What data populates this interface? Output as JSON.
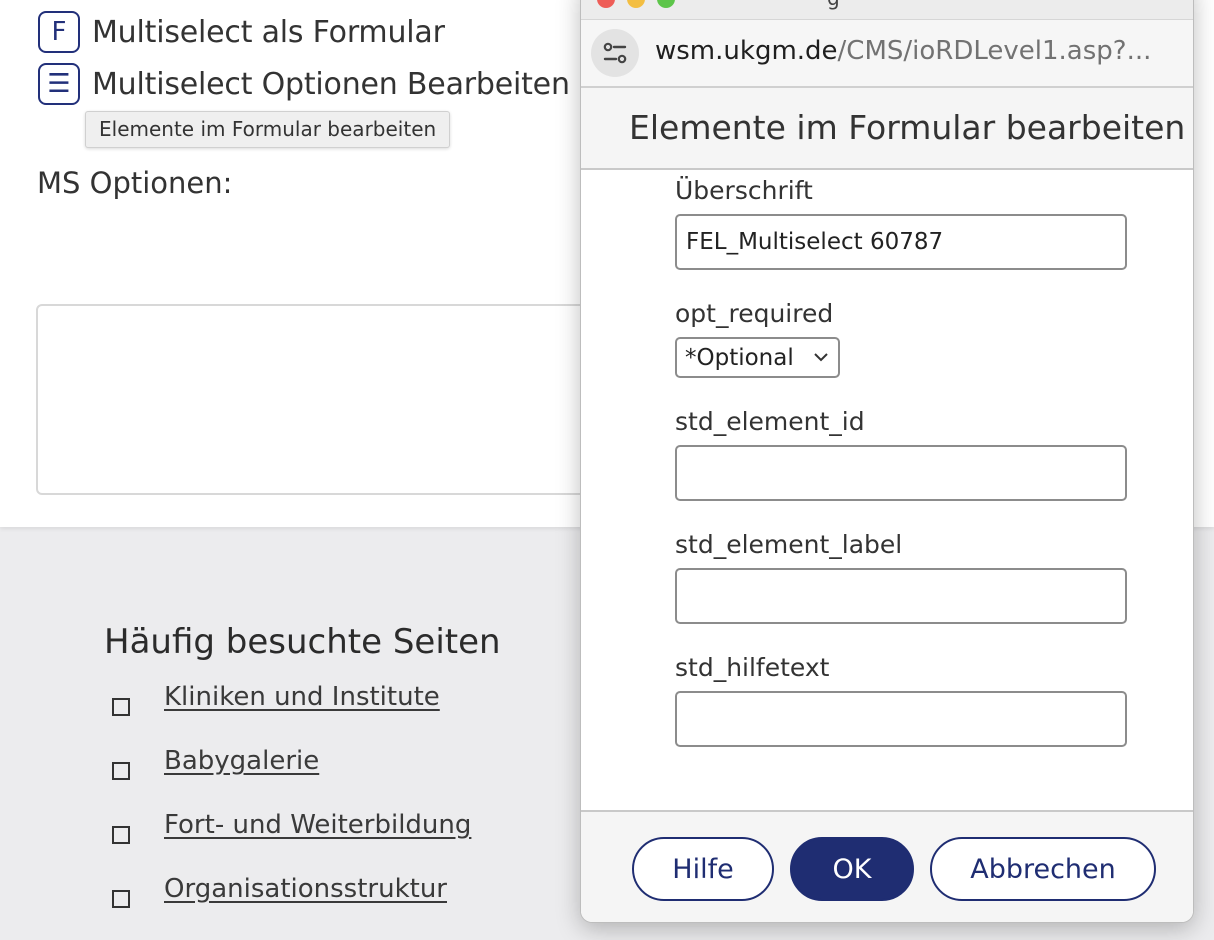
{
  "background": {
    "tools": [
      {
        "icon_glyph": "F",
        "icon_name": "form-icon",
        "label": "Multiselect als Formular"
      },
      {
        "icon_glyph": "☰",
        "icon_name": "list-icon",
        "label": "Multiselect Optionen Bearbeiten"
      }
    ],
    "tooltip": "Elemente im Formular bearbeiten",
    "ms_options_label": "MS Optionen:",
    "frequent": {
      "title": "Häufig besuchte Seiten",
      "links": [
        "Kliniken und Institute",
        "Babygalerie",
        "Fort- und Weiterbildung",
        "Organisationsstruktur"
      ]
    }
  },
  "popup": {
    "window_title": "g",
    "url": {
      "host": "wsm.ukgm.de",
      "path": "/CMS/ioRDLevel1.asp?..."
    },
    "dialog_title": "Elemente im Formular bearbeiten",
    "fields": {
      "heading": {
        "label": "Überschrift",
        "value": "FEL_Multiselect 60787"
      },
      "required": {
        "label": "opt_required",
        "selected": "*Optional"
      },
      "element_id": {
        "label": "std_element_id",
        "value": ""
      },
      "element_label": {
        "label": "std_element_label",
        "value": ""
      },
      "help_text": {
        "label": "std_hilfetext",
        "value": ""
      }
    },
    "buttons": {
      "help": "Hilfe",
      "ok": "OK",
      "cancel": "Abbrechen"
    }
  },
  "colors": {
    "accent": "#1f2d72",
    "page_bg": "#ececee"
  }
}
